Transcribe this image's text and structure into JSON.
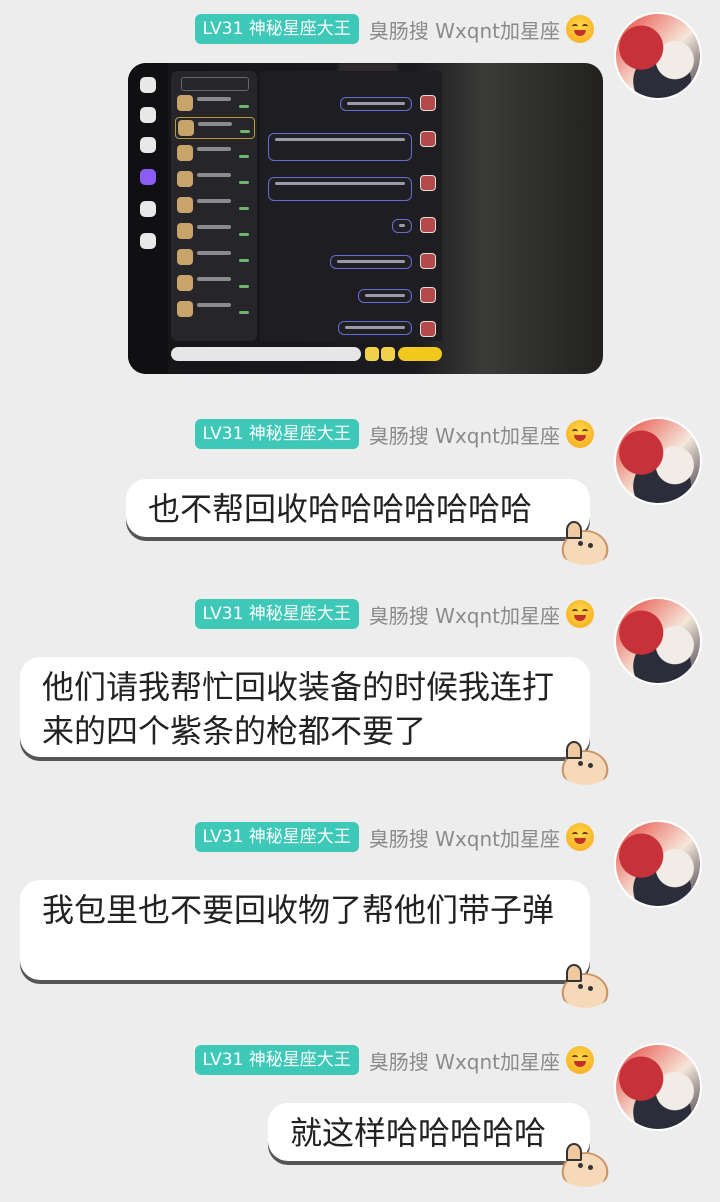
{
  "sender": {
    "badge": "LV31 神秘星座大王",
    "nickname": "臭肠搜 Wxqnt加星座",
    "nickname_emoji_icon": "yum-face-emoji-icon",
    "badge_color": "#3ec8b8"
  },
  "messages": [
    {
      "type": "image",
      "icon": "game-chat-screenshot-image"
    },
    {
      "type": "text",
      "text": "也不帮回收哈哈哈哈哈哈哈"
    },
    {
      "type": "text",
      "text": "他们请我帮忙回收装备的时候我连打来的四个紫条的枪都不要了"
    },
    {
      "type": "text",
      "text": "我包里也不要回收物了帮他们带子弹"
    },
    {
      "type": "text",
      "text": "就这样哈哈哈哈哈"
    }
  ]
}
